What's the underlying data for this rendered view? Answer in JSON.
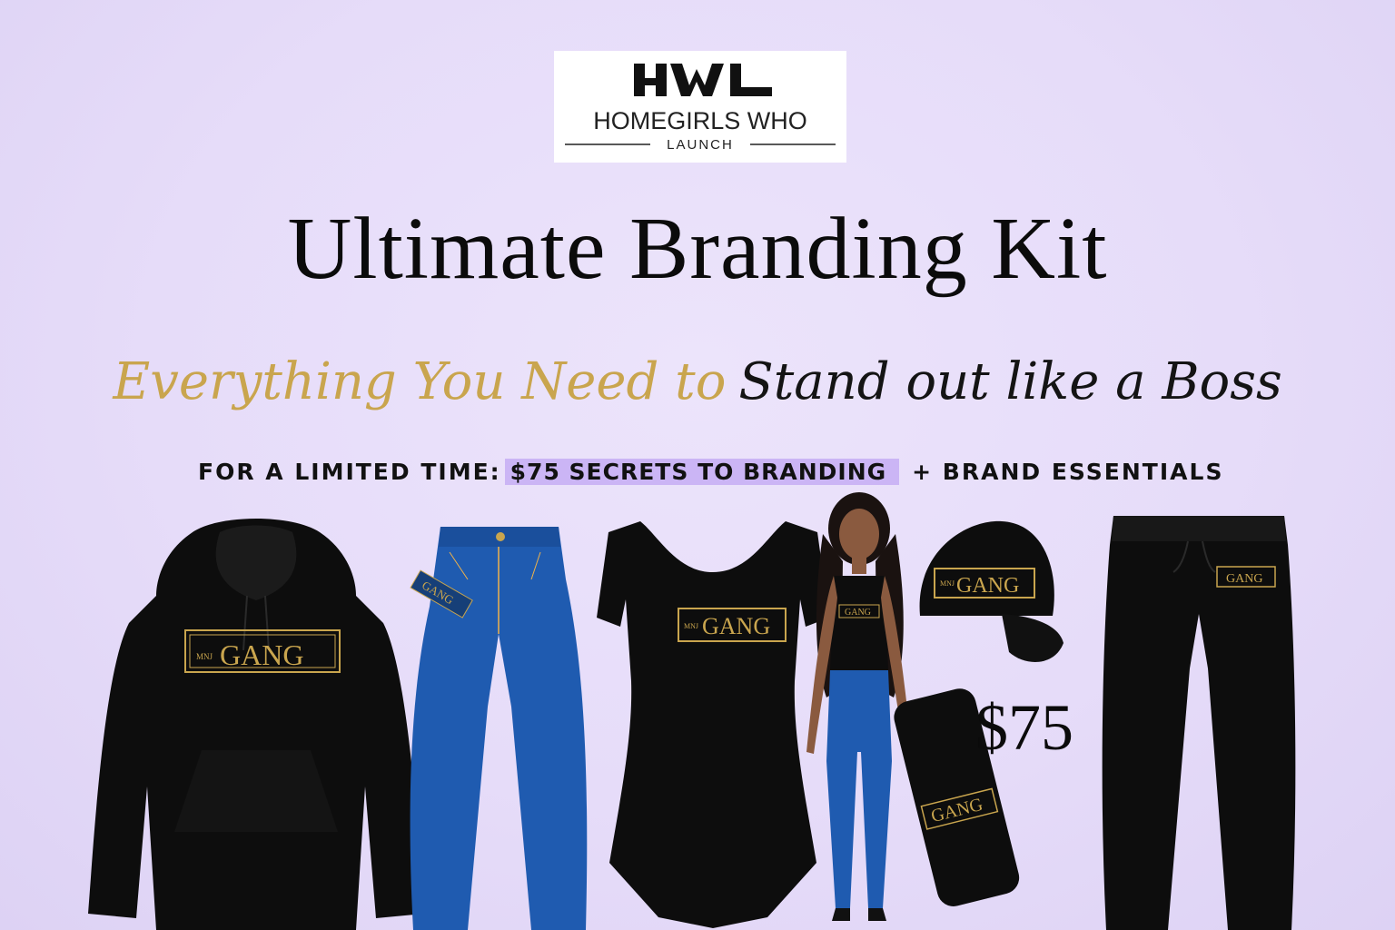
{
  "logo": {
    "mark": "HWL",
    "name": "HOMEGIRLS WHO",
    "sub": "LAUNCH"
  },
  "title": "Ultimate Branding Kit",
  "tagline": {
    "gold": "Everything You Need to",
    "dark": "Stand out like a Boss"
  },
  "offer": {
    "prefix": "FOR A LIMITED TIME:",
    "highlight": "$75 SECRETS TO BRANDING",
    "suffix": "+ BRAND ESSENTIALS"
  },
  "price": "$75",
  "products": [
    {
      "name": "hoodie",
      "brand": "GANG",
      "brand_small": "MNJ"
    },
    {
      "name": "jeans",
      "brand": "GANG"
    },
    {
      "name": "bodysuit",
      "brand": "GANG",
      "brand_small": "MNJ"
    },
    {
      "name": "model",
      "brand": "GANG"
    },
    {
      "name": "cap",
      "brand": "GANG",
      "brand_small": "MNJ"
    },
    {
      "name": "phone-case",
      "brand": "GANG"
    },
    {
      "name": "sweatpants",
      "brand": "GANG"
    }
  ],
  "colors": {
    "background": "#e6dcf9",
    "gold": "#c9a54e",
    "highlight": "#cbb5f5",
    "denim": "#1f5bb0",
    "garment": "#0d0d0d"
  }
}
